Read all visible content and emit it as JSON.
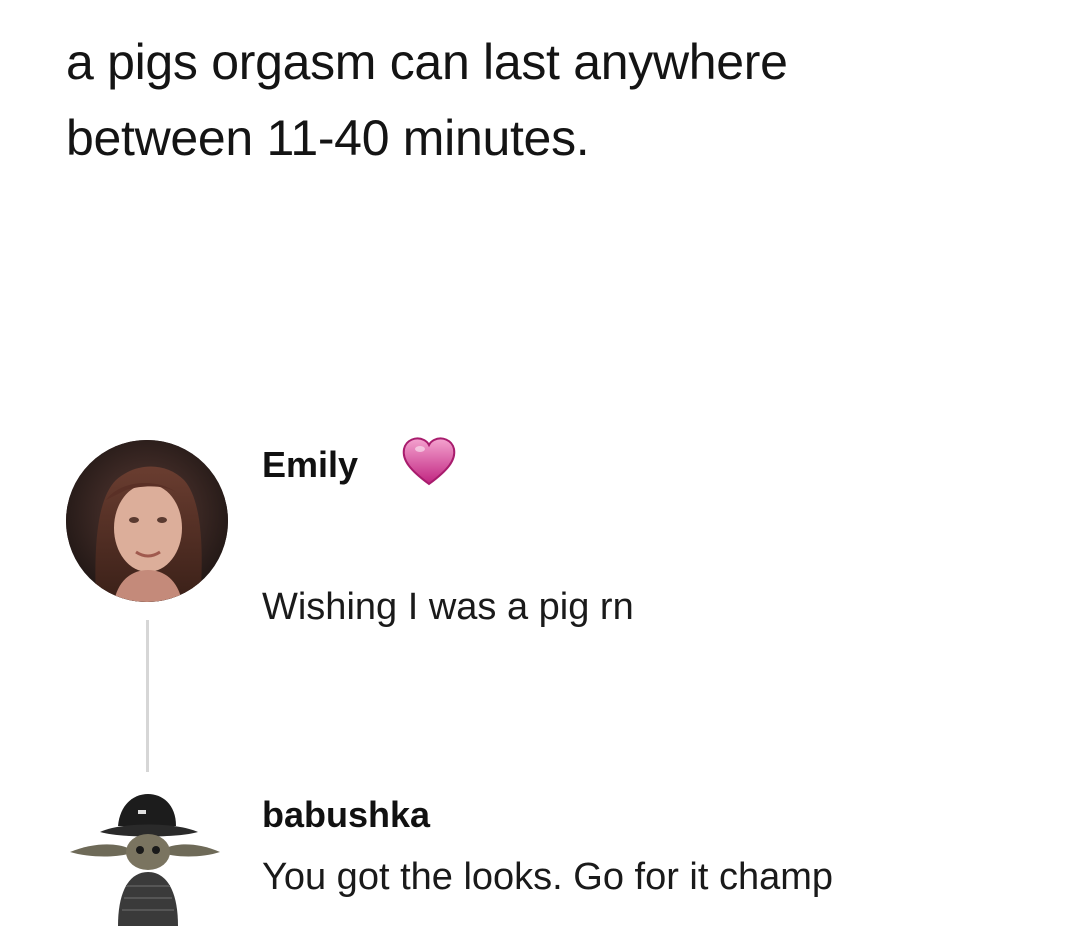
{
  "post": {
    "text_line1": "a pigs orgasm can last anywhere",
    "text_line2": "between 11-40 minutes."
  },
  "comments": [
    {
      "username": "Emily",
      "badge_icon": "pink-heart-icon",
      "text": "Wishing I was a pig rn",
      "avatar": "profile-photo"
    },
    {
      "username": "babushka",
      "text": "You got the looks. Go for it champ",
      "avatar": "baby-yoda-hat-figure"
    }
  ],
  "colors": {
    "heart": "#e85aa8",
    "thread_line": "#d6d6d6"
  }
}
